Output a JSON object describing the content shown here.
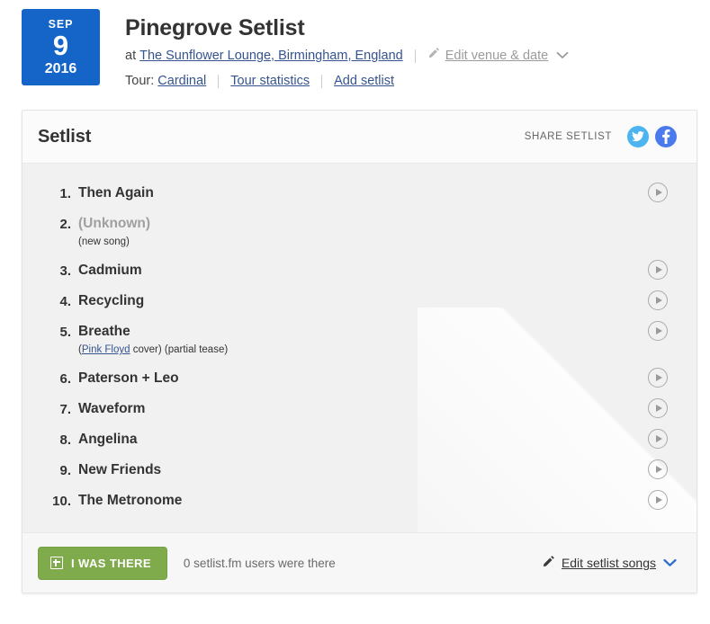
{
  "header": {
    "date": {
      "month": "SEP",
      "day": "9",
      "year": "2016",
      "box_color": "#1565c8"
    },
    "title": "Pinegrove Setlist",
    "at_prefix": "at",
    "venue": "The Sunflower Lounge, Birmingham, England",
    "edit_venue_label": "Edit venue & date",
    "edit_venue_icon": "pencil-icon",
    "edit_venue_chevron": "chevron-down-icon",
    "tour_prefix": "Tour:",
    "tour_name": "Cardinal",
    "tour_statistics_label": "Tour statistics",
    "add_setlist_label": "Add setlist",
    "link_color": "#35548f"
  },
  "card": {
    "title": "Setlist",
    "share_label": "SHARE SETLIST",
    "share_buttons": [
      {
        "name": "twitter-share-button",
        "icon": "twitter-icon",
        "color": "#4cb5f0"
      },
      {
        "name": "facebook-share-button",
        "icon": "facebook-icon",
        "color": "#4a7aeb"
      }
    ]
  },
  "setlist": [
    {
      "num": "1.",
      "name": "Then Again",
      "unknown": false,
      "note": "",
      "has_play": true
    },
    {
      "num": "2.",
      "name": "(Unknown)",
      "unknown": true,
      "note": "(new song)",
      "has_play": false
    },
    {
      "num": "3.",
      "name": "Cadmium",
      "unknown": false,
      "note": "",
      "has_play": true
    },
    {
      "num": "4.",
      "name": "Recycling",
      "unknown": false,
      "note": "",
      "has_play": true
    },
    {
      "num": "5.",
      "name": "Breathe",
      "unknown": false,
      "note_pre": "(",
      "note_link": "Pink Floyd",
      "note_post": " cover) (partial tease)",
      "has_play": true
    },
    {
      "num": "6.",
      "name": "Paterson + Leo",
      "unknown": false,
      "note": "",
      "has_play": true
    },
    {
      "num": "7.",
      "name": "Waveform",
      "unknown": false,
      "note": "",
      "has_play": true
    },
    {
      "num": "8.",
      "name": "Angelina",
      "unknown": false,
      "note": "",
      "has_play": true
    },
    {
      "num": "9.",
      "name": "New Friends",
      "unknown": false,
      "note": "",
      "has_play": true
    },
    {
      "num": "10.",
      "name": "The Metronome",
      "unknown": false,
      "note": "",
      "has_play": true
    }
  ],
  "footer": {
    "i_was_there_label": "I WAS THERE",
    "i_was_there_icon": "plus-box-icon",
    "i_was_there_color": "#7fab4d",
    "attendance_text": "0 setlist.fm users were there",
    "edit_songs_label": "Edit setlist songs",
    "edit_songs_icon": "pencil-icon",
    "edit_songs_chevron": "chevron-down-icon"
  }
}
